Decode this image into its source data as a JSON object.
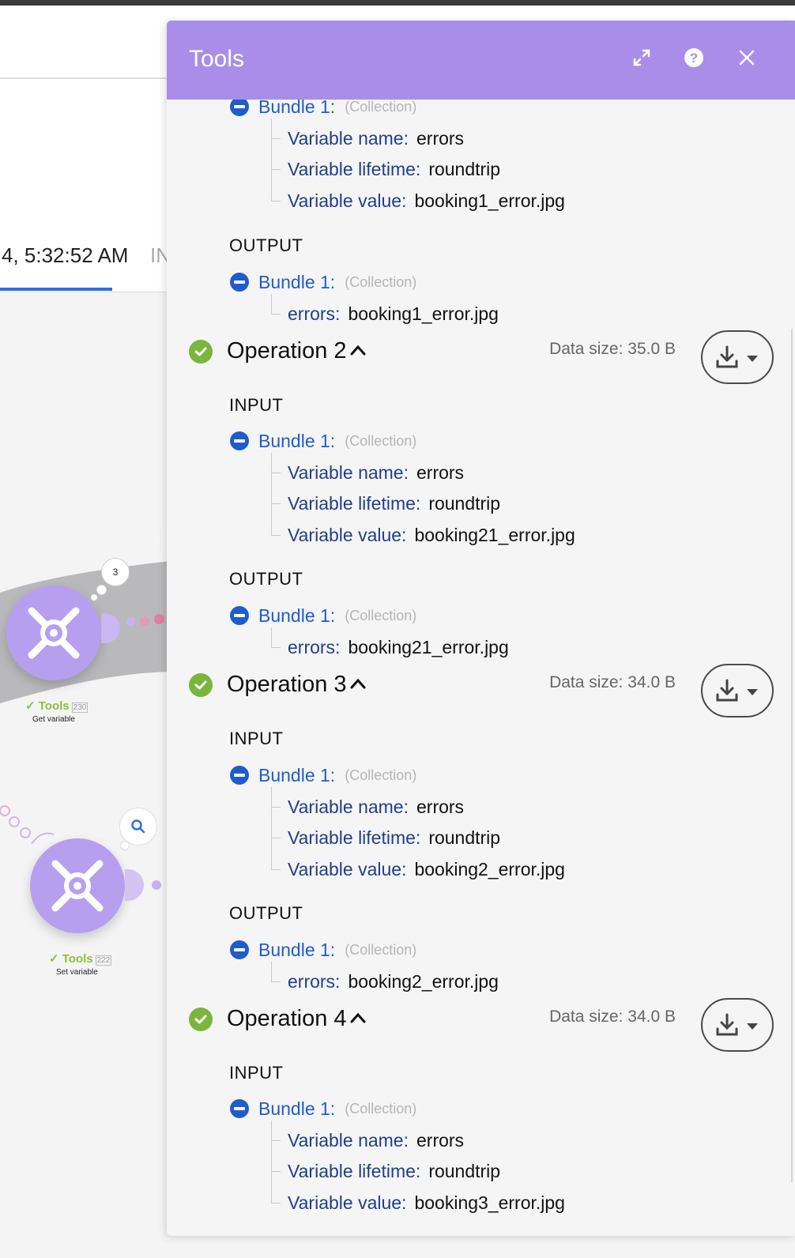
{
  "background": {
    "timestamp": "4, 5:32:52 AM",
    "tab_partial": "IN",
    "nodes": [
      {
        "app": "Tools",
        "id": "230",
        "action": "Get variable",
        "bubble_count": "3"
      },
      {
        "app": "Tools",
        "id": "222",
        "action": "Set variable"
      }
    ]
  },
  "panel": {
    "title": "Tools",
    "icons": [
      "expand-icon",
      "help-icon",
      "close-icon"
    ],
    "accent_color": "#a88ee9",
    "link_color": "#1f5ccc",
    "success_color": "#7ab53d"
  },
  "operation1": {
    "input": {
      "bundle_label": "Bundle 1:",
      "bundle_type": "(Collection)",
      "var_name_key": "Variable name:",
      "var_name_val": "errors",
      "lifetime_key": "Variable lifetime:",
      "lifetime_val": "roundtrip",
      "value_key": "Variable value:",
      "value_val": "booking1_error.jpg"
    },
    "output_label": "OUTPUT",
    "output": {
      "bundle_label": "Bundle 1:",
      "bundle_type": "(Collection)",
      "key": "errors:",
      "val": "booking1_error.jpg"
    }
  },
  "operations": [
    {
      "title": "Operation 2",
      "data_size": "Data size: 35.0 B",
      "input_label": "INPUT",
      "input": {
        "bundle_label": "Bundle 1:",
        "bundle_type": "(Collection)",
        "var_name_key": "Variable name:",
        "var_name_val": "errors",
        "lifetime_key": "Variable lifetime:",
        "lifetime_val": "roundtrip",
        "value_key": "Variable value:",
        "value_val": "booking21_error.jpg"
      },
      "output_label": "OUTPUT",
      "output": {
        "bundle_label": "Bundle 1:",
        "bundle_type": "(Collection)",
        "key": "errors:",
        "val": "booking21_error.jpg"
      }
    },
    {
      "title": "Operation 3",
      "data_size": "Data size: 34.0 B",
      "input_label": "INPUT",
      "input": {
        "bundle_label": "Bundle 1:",
        "bundle_type": "(Collection)",
        "var_name_key": "Variable name:",
        "var_name_val": "errors",
        "lifetime_key": "Variable lifetime:",
        "lifetime_val": "roundtrip",
        "value_key": "Variable value:",
        "value_val": "booking2_error.jpg"
      },
      "output_label": "OUTPUT",
      "output": {
        "bundle_label": "Bundle 1:",
        "bundle_type": "(Collection)",
        "key": "errors:",
        "val": "booking2_error.jpg"
      }
    },
    {
      "title": "Operation 4",
      "data_size": "Data size: 34.0 B",
      "input_label": "INPUT",
      "input": {
        "bundle_label": "Bundle 1:",
        "bundle_type": "(Collection)",
        "var_name_key": "Variable name:",
        "var_name_val": "errors",
        "lifetime_key": "Variable lifetime:",
        "lifetime_val": "roundtrip",
        "value_key": "Variable value:",
        "value_val": "booking3_error.jpg"
      }
    }
  ]
}
